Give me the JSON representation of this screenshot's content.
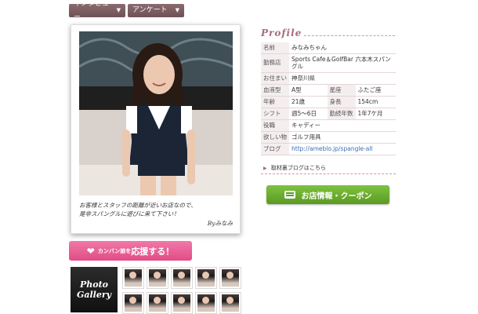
{
  "nav": {
    "tabs": [
      {
        "label": "インタビュー"
      },
      {
        "label": "アンケート"
      }
    ]
  },
  "polaroid": {
    "message_line1": "お客様とスタッフの距離が近いお店なので、",
    "message_line2": "是非スパングルに遊びに来て下さい！",
    "signature": "Byみなみ"
  },
  "profile": {
    "heading": "Profile",
    "rows": [
      {
        "label": "名前",
        "value": "みなみちゃん"
      },
      {
        "label": "勤務店",
        "value": "Sports Cafe＆GolfBar 六本木スパングル"
      },
      {
        "label": "お住まい",
        "value": "神奈川県"
      },
      {
        "label": "血液型",
        "value": "A型",
        "label2": "星座",
        "value2": "ふたご座"
      },
      {
        "label": "年齢",
        "value": "21歳",
        "label2": "身長",
        "value2": "154cm"
      },
      {
        "label": "シフト",
        "value": "週5～6日",
        "label2": "勤続年数",
        "value2": "1年7ケ月"
      },
      {
        "label": "役職",
        "value": "キャディー"
      },
      {
        "label": "欲しい物",
        "value": "ゴルフ用具"
      },
      {
        "label": "ブログ",
        "value": "http://ameblo.jp/spangle-all"
      }
    ],
    "blog_link": "取材裏ブログはこちら"
  },
  "buttons": {
    "shop_info": "お店情報・クーポン",
    "support_small": "カンバン娘を",
    "support_big": "応援する！"
  },
  "gallery": {
    "line1": "Photo",
    "line2": "Gallery",
    "thumb_count": 10
  },
  "colors": {
    "nav_tab": "#6f5155",
    "profile_accent": "#a86b7a",
    "shop_button": "#5a9a22",
    "support_button": "#e04d86",
    "link": "#3b6fb6"
  }
}
